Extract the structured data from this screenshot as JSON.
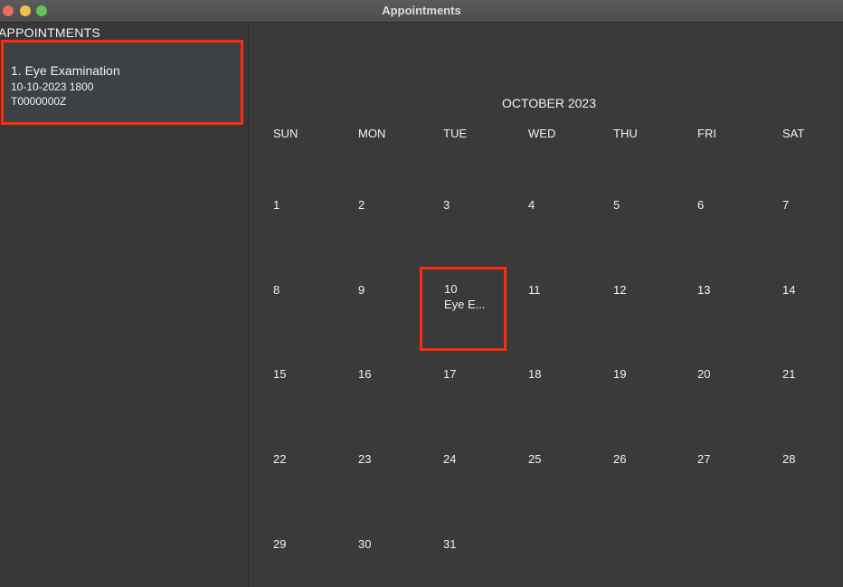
{
  "window": {
    "title": "Appointments"
  },
  "sidebar": {
    "header": "APPOINTMENTS",
    "appointments": [
      {
        "title": "1. Eye Examination",
        "datetime": "10-10-2023 1800",
        "ic": "T0000000Z"
      }
    ]
  },
  "calendar": {
    "month_label": "OCTOBER 2023",
    "weekdays": [
      "SUN",
      "MON",
      "TUE",
      "WED",
      "THU",
      "FRI",
      "SAT"
    ],
    "weeks": [
      [
        "1",
        "2",
        "3",
        "4",
        "5",
        "6",
        "7"
      ],
      [
        "8",
        "9",
        "10",
        "11",
        "12",
        "13",
        "14"
      ],
      [
        "15",
        "16",
        "17",
        "18",
        "19",
        "20",
        "21"
      ],
      [
        "22",
        "23",
        "24",
        "25",
        "26",
        "27",
        "28"
      ],
      [
        "29",
        "30",
        "31",
        "",
        "",
        "",
        ""
      ]
    ],
    "selected_day": {
      "day": "10",
      "event": "Eye E..."
    }
  },
  "colors": {
    "highlight": "#ff2a10",
    "background": "#3a3a3a"
  }
}
